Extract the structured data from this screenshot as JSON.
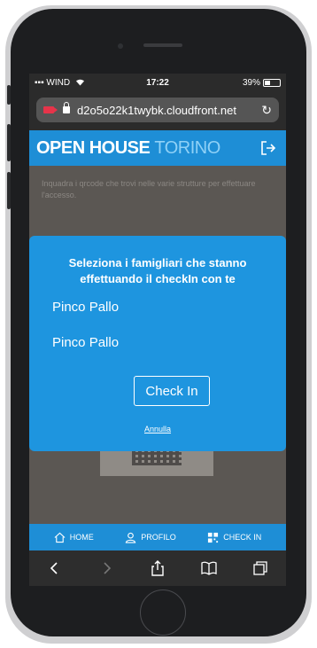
{
  "status_bar": {
    "carrier": "WIND",
    "time": "17:22",
    "battery": "39%",
    "battery_level": 0.39
  },
  "browser": {
    "url": "d2o5o22k1twybk.cloudfront.net"
  },
  "app": {
    "brand_bold": "OPEN HOUSE",
    "brand_light": "TORINO"
  },
  "page": {
    "instructions": "Inquadra i qrcode che trovi nelle varie strutture per effettuare l'accesso."
  },
  "modal": {
    "title": "Seleziona i famigliari che stanno effettuando il checkIn con te",
    "members": [
      "Pinco Pallo",
      "Pinco Pallo"
    ],
    "checkin_label": "Check In",
    "cancel_label": "Annulla"
  },
  "tabs": [
    {
      "label": "HOME",
      "icon": "home-icon"
    },
    {
      "label": "PROFILO",
      "icon": "user-icon"
    },
    {
      "label": "CHECK IN",
      "icon": "qrcode-icon"
    }
  ],
  "colors": {
    "brand_blue": "#1e8ed6",
    "modal_blue": "#1e95df",
    "record_red": "#e6344a"
  }
}
